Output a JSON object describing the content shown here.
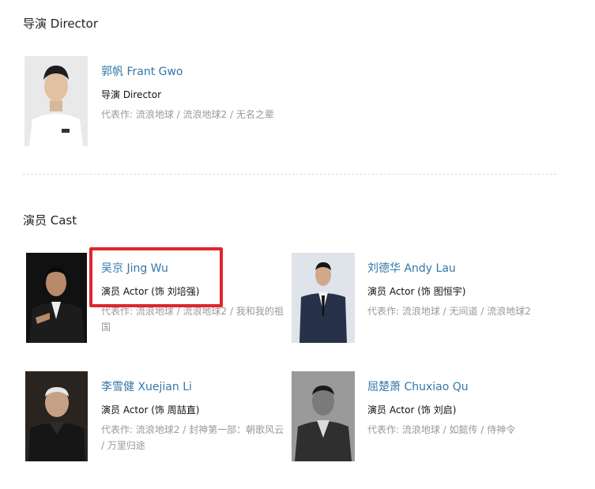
{
  "director_section": {
    "title": "导演 Director"
  },
  "directors": [
    {
      "name": "郭帆 Frant Gwo",
      "role": "导演 Director",
      "works": "代表作:  流浪地球 / 流浪地球2 / 无名之辈"
    }
  ],
  "cast_section": {
    "title": "演员 Cast"
  },
  "cast": [
    {
      "name": "吴京 Jing Wu",
      "role": "演员 Actor (饰 刘培强)",
      "works": "代表作:  流浪地球 / 流浪地球2 / 我和我的祖国"
    },
    {
      "name": "刘德华 Andy Lau",
      "role": "演员 Actor (饰 图恒宇)",
      "works": "代表作:  流浪地球 / 无间道 / 流浪地球2"
    },
    {
      "name": "李雪健 Xuejian Li",
      "role": "演员 Actor (饰 周喆直)",
      "works": "代表作:  流浪地球2 / 封神第一部：朝歌风云 / 万里归途"
    },
    {
      "name": "屈楚萧 Chuxiao Qu",
      "role": "演员 Actor (饰 刘启)",
      "works": "代表作:  流浪地球 / 如懿传 / 侍神令"
    }
  ],
  "colors": {
    "link": "#3377aa",
    "muted": "#999999",
    "highlight": "#e0262c"
  }
}
